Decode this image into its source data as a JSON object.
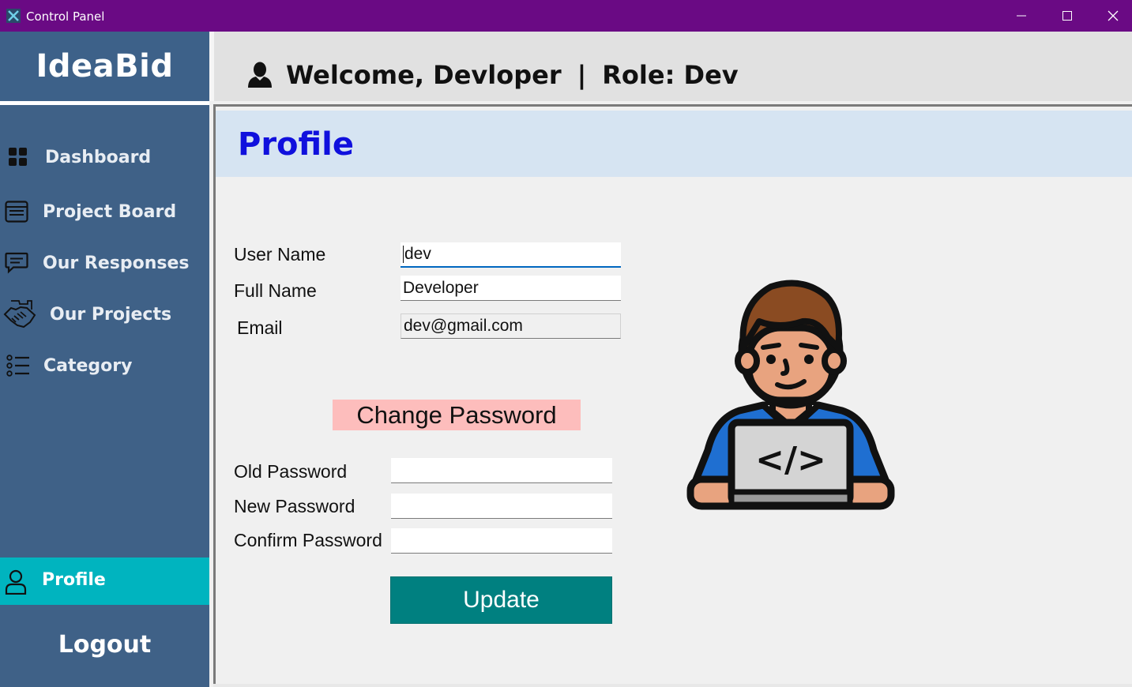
{
  "window": {
    "title": "Control Panel",
    "controls": {
      "minimize": "minimize",
      "maximize": "maximize",
      "close": "close"
    }
  },
  "sidebar": {
    "logo": "IdeaBid",
    "items": [
      {
        "label": "Dashboard",
        "icon": "dashboard-icon"
      },
      {
        "label": "Project Board",
        "icon": "board-icon"
      },
      {
        "label": "Our Responses",
        "icon": "chat-icon"
      },
      {
        "label": "Our Projects",
        "icon": "handshake-icon"
      },
      {
        "label": "Category",
        "icon": "list-icon"
      }
    ],
    "active_item": {
      "label": "Profile",
      "icon": "user-icon"
    },
    "logout_label": "Logout"
  },
  "header": {
    "welcome": "Welcome, Devloper",
    "separator": "|",
    "role": "Role: Dev"
  },
  "section": {
    "title": "Profile"
  },
  "profile_form": {
    "username_label": "User Name",
    "username_value": "dev",
    "fullname_label": "Full Name",
    "fullname_value": "Developer",
    "email_label": "Email",
    "email_value": "dev@gmail.com"
  },
  "password_form": {
    "heading": "Change Password",
    "old_label": "Old Password",
    "old_value": "",
    "new_label": "New Password",
    "new_value": "",
    "confirm_label": "Confirm Password",
    "confirm_value": "",
    "update_label": "Update"
  },
  "illustration": {
    "icon": "developer-laptop-icon",
    "code_symbol": "</>"
  },
  "colors": {
    "titlebar": "#6a0a84",
    "sidebar": "#3f6187",
    "active_nav": "#00b4bf",
    "section_bar": "#d6e4f2",
    "section_title": "#1010dd",
    "change_password_bg": "#fdbdbc",
    "update_button": "#008080"
  }
}
